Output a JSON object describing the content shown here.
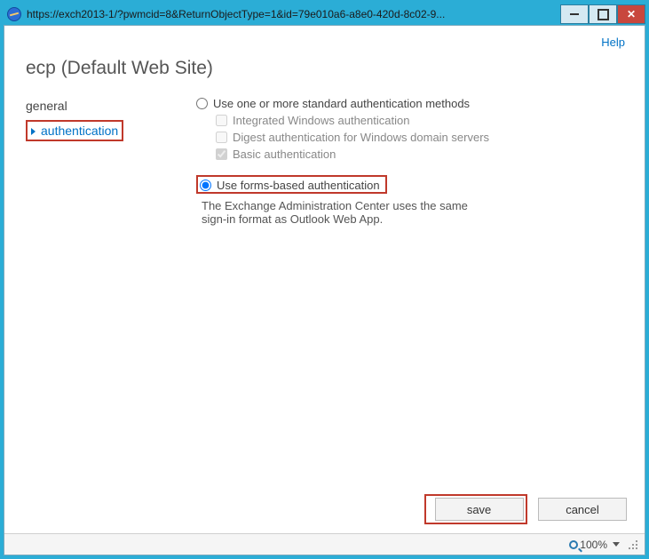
{
  "window": {
    "url": "https://exch2013-1/?pwmcid=8&ReturnObjectType=1&id=79e010a6-a8e0-420d-8c02-9..."
  },
  "help_label": "Help",
  "page_title": "ecp (Default Web Site)",
  "nav": {
    "general": "general",
    "authentication": "authentication"
  },
  "auth": {
    "standard_label": "Use one or more standard authentication methods",
    "integrated": "Integrated Windows authentication",
    "digest": "Digest authentication for Windows domain servers",
    "basic": "Basic authentication",
    "forms_label": "Use forms-based authentication",
    "forms_desc": "The Exchange Administration Center uses the same sign-in format as Outlook Web App."
  },
  "buttons": {
    "save": "save",
    "cancel": "cancel"
  },
  "status": {
    "zoom": "100%"
  }
}
